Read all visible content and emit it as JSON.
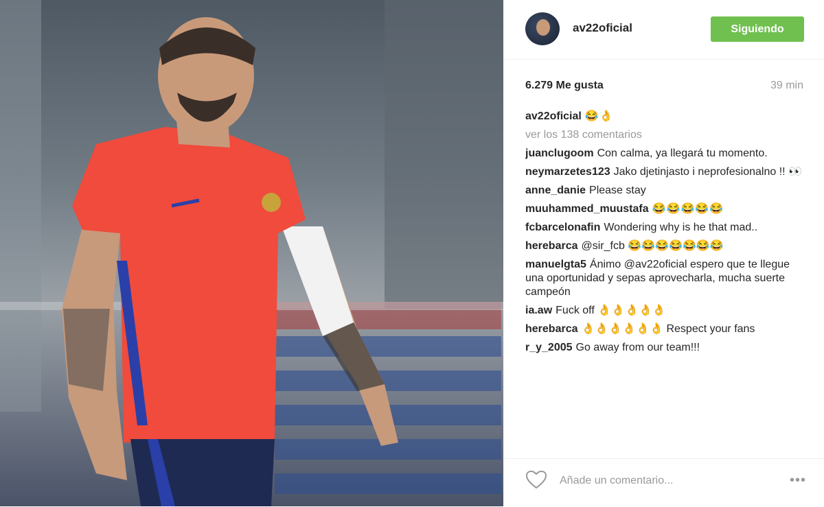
{
  "header": {
    "username": "av22oficial",
    "follow_label": "Siguiendo"
  },
  "stats": {
    "likes": "6.279 Me gusta",
    "time": "39 min"
  },
  "caption": {
    "username": "av22oficial",
    "emoji": "😂👌"
  },
  "view_all": "ver los 138 comentarios",
  "comments": [
    {
      "user": "juanclugoom",
      "text": "Con calma, ya llegará tu momento."
    },
    {
      "user": "neymarzetes123",
      "text": "Jako djetinjasto i neprofesionalno !! 👀"
    },
    {
      "user": "anne_danie",
      "text": "Please stay"
    },
    {
      "user": "muuhammed_muustafa",
      "text": "😂😂😂😂😂"
    },
    {
      "user": "fcbarcelonafin",
      "text": "Wondering why is he that mad.."
    },
    {
      "user": "herebarca",
      "text": "@sir_fcb 😂😂😂😂😂😂😂"
    },
    {
      "user": "manuelgta5",
      "text": "Ánimo @av22oficial espero que te llegue una oportunidad y sepas aprovecharla, mucha suerte campeón"
    },
    {
      "user": "ia.aw",
      "text": "Fuck off 👌👌👌👌👌"
    },
    {
      "user": "herebarca",
      "text": "👌👌👌👌👌👌 Respect your fans"
    },
    {
      "user": "r_y_2005",
      "text": "Go away from our team!!!"
    }
  ],
  "footer": {
    "placeholder": "Añade un comentario...",
    "more": "•••"
  },
  "colors": {
    "follow_button": "#70c050",
    "jersey": "#f04b3c",
    "shorts": "#1e2a52"
  }
}
